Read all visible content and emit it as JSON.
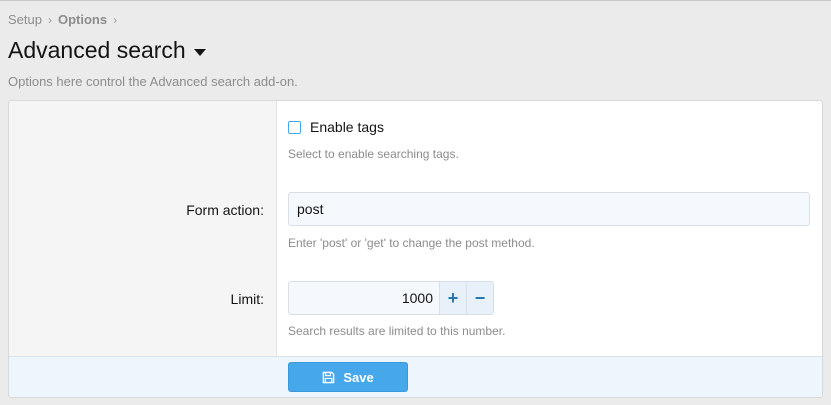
{
  "breadcrumb": {
    "items": [
      "Setup",
      "Options"
    ],
    "separator": "›"
  },
  "header": {
    "title": "Advanced search",
    "dropdown_icon": "caret-down-icon",
    "description": "Options here control the Advanced search add-on."
  },
  "form": {
    "enable_tags": {
      "label": "Enable tags",
      "checked": false,
      "hint": "Select to enable searching tags."
    },
    "form_action": {
      "label": "Form action:",
      "value": "post",
      "hint": "Enter 'post' or 'get' to change the post method."
    },
    "limit": {
      "label": "Limit:",
      "value": "1000",
      "increment_label": "+",
      "decrement_label": "−",
      "hint": "Search results are limited to this number."
    }
  },
  "footer": {
    "save_label": "Save",
    "save_icon": "floppy-disk-icon"
  },
  "colors": {
    "accent": "#47a7eb",
    "background": "#ebebeb",
    "panel": "#ffffff",
    "label_column": "#f5f5f5",
    "footer": "#edf6fd",
    "muted_text": "#8c8c8c"
  }
}
